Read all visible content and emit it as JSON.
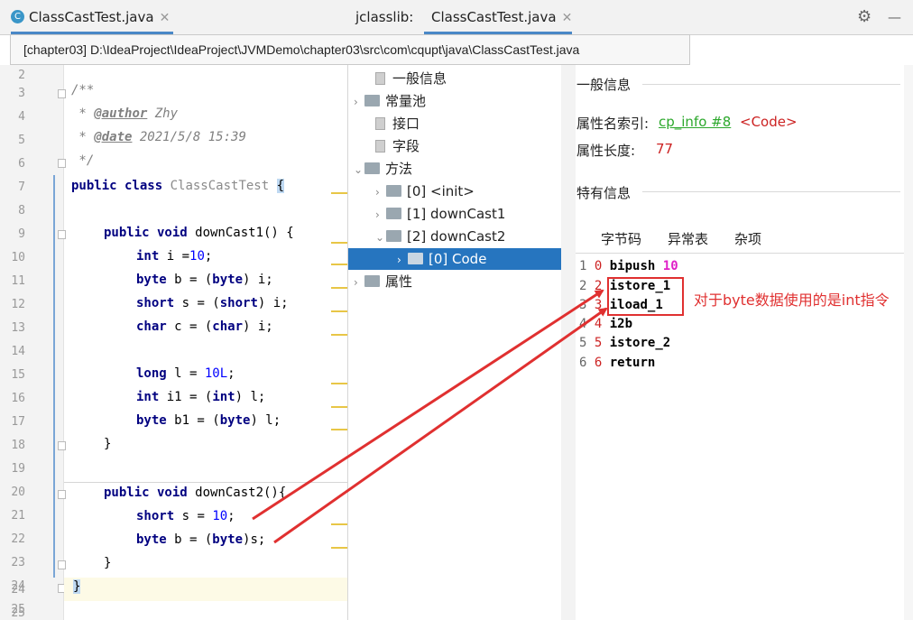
{
  "left_tab": {
    "icon": "C",
    "label": "ClassCastTest.java",
    "close": "✕"
  },
  "right_tab": {
    "prefix": "jclasslib:",
    "label": "ClassCastTest.java",
    "close": "✕"
  },
  "toolbar": {
    "settings": "⚙",
    "minimize": "—"
  },
  "tooltip": "[chapter03] D:\\IdeaProject\\IdeaProject\\JVMDemo\\chapter03\\src\\com\\cqupt\\java\\ClassCastTest.java",
  "line_numbers": [
    "2",
    "3",
    "4",
    "5",
    "6",
    "7",
    "8",
    "9",
    "10",
    "11",
    "12",
    "13",
    "14",
    "15",
    "16",
    "17",
    "18",
    "19",
    "20",
    "21",
    "22",
    "23",
    "24",
    "25"
  ],
  "code": {
    "l3": "/**",
    "l4_pre": " * ",
    "l4_tag": "@author",
    "l4_val": " Zhy",
    "l5_pre": " * ",
    "l5_tag": "@date",
    "l5_val": " 2021/5/8 15:39",
    "l6": " */",
    "l7_kw": "public class",
    "l7_name": " ClassCastTest ",
    "l7_brace": "{",
    "l9_kw": "public void",
    "l9_rest": " downCast1() {",
    "l10_kw": "int",
    "l10_a": " i =",
    "l10_num": "10",
    "l10_b": ";",
    "l11_kw": "byte",
    "l11_a": " b = (",
    "l11_kw2": "byte",
    "l11_b": ") i;",
    "l12_kw": "short",
    "l12_a": " s = (",
    "l12_kw2": "short",
    "l12_b": ") i;",
    "l13_kw": "char",
    "l13_a": " c = (",
    "l13_kw2": "char",
    "l13_b": ") i;",
    "l15_kw": "long",
    "l15_a": " l = ",
    "l15_num": "10L",
    "l15_b": ";",
    "l16_kw": "int",
    "l16_a": " i1 = (",
    "l16_kw2": "int",
    "l16_b": ") l;",
    "l17_kw": "byte",
    "l17_a": " b1 = (",
    "l17_kw2": "byte",
    "l17_b": ") l;",
    "l18": "}",
    "l20_kw": "public void",
    "l20_rest": " downCast2(){",
    "l21_kw": "short",
    "l21_a": " s = ",
    "l21_num": "10",
    "l21_b": ";",
    "l22_kw": "byte",
    "l22_a": " b = (",
    "l22_kw2": "byte",
    "l22_b": ")s;",
    "l23": "}",
    "l24": "}"
  },
  "tree": {
    "general": "一般信息",
    "constant_pool": "常量池",
    "interfaces": "接口",
    "fields": "字段",
    "methods": "方法",
    "m0": "[0] <init>",
    "m1": "[1] downCast1",
    "m2": "[2] downCast2",
    "code": "[0] Code",
    "attributes": "属性",
    "arrow_right": "›",
    "arrow_down": "⌄"
  },
  "info": {
    "general_header": "一般信息",
    "name_index_label": "属性名索引:",
    "name_index_link": "cp_info #8",
    "name_index_value": "<Code>",
    "length_label": "属性长度:",
    "length_value": "77",
    "specific_header": "特有信息"
  },
  "subtabs": [
    "字节码",
    "异常表",
    "杂项"
  ],
  "bytecode": [
    {
      "ln": "1",
      "idx": "0",
      "op": "bipush",
      "arg": "10"
    },
    {
      "ln": "2",
      "idx": "2",
      "op": "istore_1",
      "arg": ""
    },
    {
      "ln": "3",
      "idx": "3",
      "op": "iload_1",
      "arg": ""
    },
    {
      "ln": "4",
      "idx": "4",
      "op": "i2b",
      "arg": ""
    },
    {
      "ln": "5",
      "idx": "5",
      "op": "istore_2",
      "arg": ""
    },
    {
      "ln": "6",
      "idx": "6",
      "op": "return",
      "arg": ""
    }
  ],
  "annotation": "对于byte数据使用的是int指令",
  "colors": {
    "accent": "#4a88c7",
    "selection": "#2675bf",
    "annotation": "#e03030",
    "keyword": "#000080",
    "number": "#0000ff"
  }
}
